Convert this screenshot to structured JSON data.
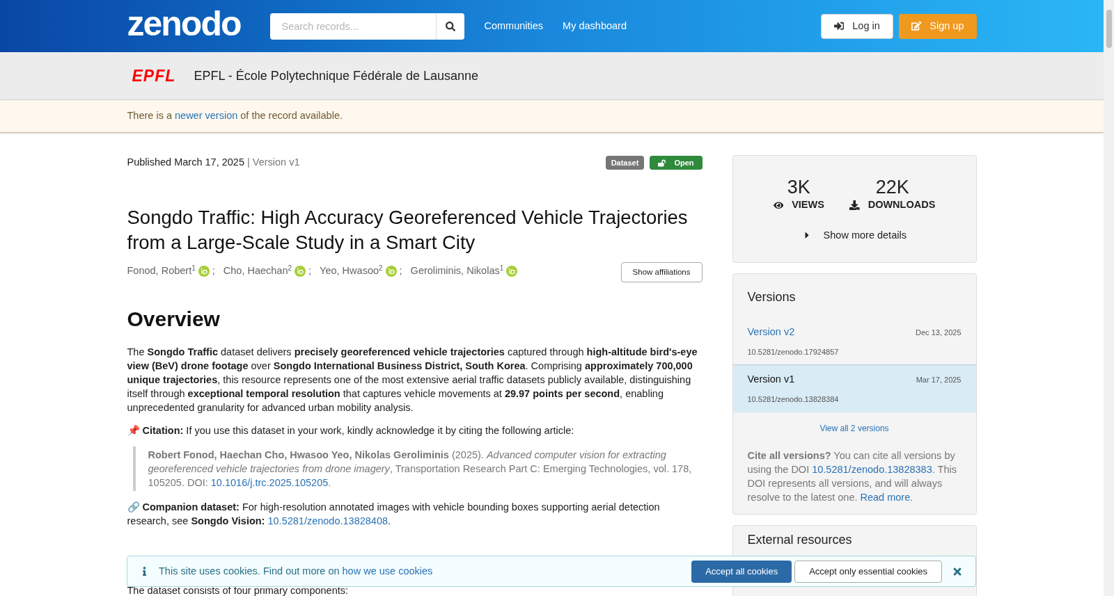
{
  "header": {
    "logo_text": "zenodo",
    "search": {
      "placeholder": "Search records..."
    },
    "nav": [
      "Communities",
      "My dashboard"
    ],
    "buttons": [
      {
        "label": "Log in",
        "kind": "login"
      },
      {
        "label": "Sign up",
        "kind": "signup"
      }
    ]
  },
  "community": {
    "logo_text": "EPFL",
    "name": "EPFL - École Polytechnique Fédérale de Lausanne"
  },
  "notice": [
    {
      "kind": "text",
      "text": "There is a "
    },
    {
      "kind": "link",
      "text": "newer version"
    },
    {
      "kind": "text",
      "text": " of the record available."
    }
  ],
  "record": {
    "published": "Published March 17, 2025",
    "version": "| Version v1",
    "badges": [
      {
        "label": "Dataset",
        "kind": "type"
      },
      {
        "label": "Open",
        "kind": "access"
      }
    ],
    "title": "Songdo Traffic: High Accuracy Georeferenced Vehicle Trajectories from a Large-Scale Study in a Smart City",
    "authors": [
      {
        "name": "Fonod, Robert",
        "aff": "1",
        "orcid": true,
        "separator": ";"
      },
      {
        "name": "Cho, Haechan",
        "aff": "2",
        "orcid": true,
        "separator": ";"
      },
      {
        "name": "Yeo, Hwasoo",
        "aff": "2",
        "orcid": true,
        "separator": ";"
      },
      {
        "name": "Geroliminis, Nikolas",
        "aff": "1",
        "orcid": true
      }
    ],
    "show_affiliations": "Show affiliations",
    "overview_heading": "Overview",
    "paragraphs": [
      {
        "kind": "plain",
        "segments": [
          {
            "kind": "text",
            "text": "The **Songdo Traffic** dataset delivers **precisely georeferenced vehicle trajectories** captured through **high-altitude bird's-eye view (BeV) drone footage** over **Songdo International Business District, South Korea**. Comprising **approximately 700,000 unique trajectories**, this resource represents one of the most extensive aerial traffic datasets publicly available, distinguishing itself through **exceptional temporal resolution** that captures vehicle movements at **29.97 points per second**, enabling unprecedented granularity for advanced urban mobility analysis."
          }
        ]
      },
      {
        "kind": "plain",
        "segments": [
          {
            "kind": "text",
            "text": "📌 **Citation:** If you use this dataset in your work, kindly acknowledge it by citing the following article:"
          }
        ]
      },
      {
        "kind": "quote",
        "segments": [
          {
            "kind": "text",
            "text": "**Robert Fonod, Haechan Cho, Hwasoo Yeo, Nikolas Geroliminis** (2025). *Advanced computer vision for extracting georeferenced vehicle trajectories from drone imagery*, Transportation Research Part C: Emerging Technologies, vol. 178, 105205. DOI: "
          },
          {
            "kind": "link",
            "text": "10.1016/j.trc.2025.105205"
          },
          {
            "kind": "text",
            "text": "."
          }
        ]
      },
      {
        "kind": "plain",
        "segments": [
          {
            "kind": "text",
            "text": "🔗 **Companion dataset:** For high-resolution annotated images with vehicle bounding boxes supporting aerial detection research, see **Songdo Vision:** "
          },
          {
            "kind": "link",
            "text": "10.5281/zenodo.13828408"
          },
          {
            "kind": "text",
            "text": "."
          }
        ]
      }
    ],
    "after_banner": "The dataset consists of four primary components:"
  },
  "stats": [
    {
      "value": "3K",
      "label": "VIEWS",
      "kind": "views"
    },
    {
      "value": "22K",
      "label": "DOWNLOADS",
      "kind": "downloads"
    }
  ],
  "show_more": "Show more details",
  "versions": {
    "heading": "Versions",
    "items": [
      {
        "title": "Version v2",
        "date": "Dec 13, 2025",
        "doi": "10.5281/zenodo.17924857",
        "selected": false
      },
      {
        "title": "Version v1",
        "date": "Mar 17, 2025",
        "doi": "10.5281/zenodo.13828384",
        "selected": true
      }
    ],
    "view_all": "View all 2 versions",
    "cite": [
      {
        "kind": "text",
        "text": "**Cite all versions?** You can cite all versions by using the DOI "
      },
      {
        "kind": "link",
        "text": "10.5281/zenodo.13828383"
      },
      {
        "kind": "text",
        "text": ". This DOI represents all versions, and will always resolve to the latest one. "
      },
      {
        "kind": "link",
        "text": "Read more"
      },
      {
        "kind": "text",
        "text": "."
      }
    ]
  },
  "external": {
    "heading": "External resources"
  },
  "cookies": {
    "segments": [
      {
        "kind": "text",
        "text": "This site uses cookies. Find out more on "
      },
      {
        "kind": "link",
        "text": "how we use cookies"
      }
    ],
    "buttons": [
      {
        "label": "Accept all cookies",
        "kind": "primary"
      },
      {
        "label": "Accept only essential cookies",
        "kind": "secondary"
      }
    ]
  }
}
